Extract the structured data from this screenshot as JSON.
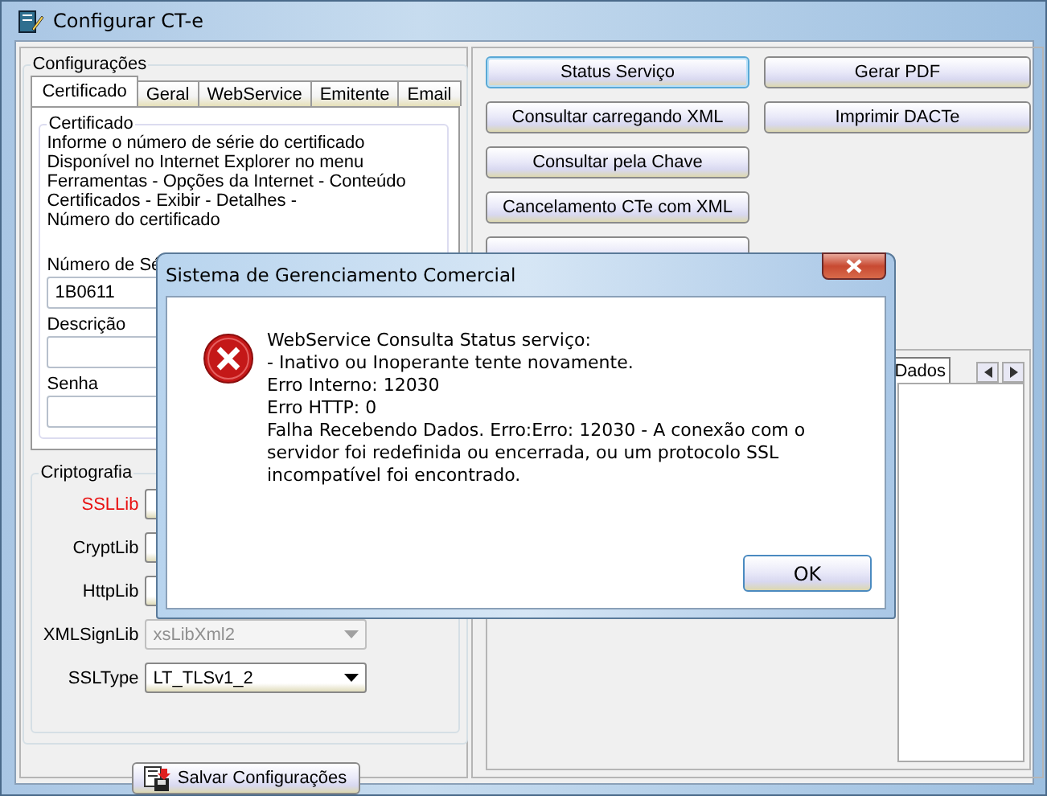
{
  "window": {
    "title": "Configurar CT-e"
  },
  "config": {
    "group_title": "Configurações",
    "tabs": [
      {
        "label": "Certificado",
        "selected": true
      },
      {
        "label": "Geral",
        "selected": false
      },
      {
        "label": "WebService",
        "selected": false
      },
      {
        "label": "Emitente",
        "selected": false
      },
      {
        "label": "Email",
        "selected": false
      }
    ],
    "certificate": {
      "group_title": "Certificado",
      "instructions": [
        "Informe o número de série do certificado",
        "Disponível no Internet Explorer no menu",
        "Ferramentas - Opções da Internet - Conteúdo",
        "Certificados - Exibir - Detalhes -",
        "Número do certificado"
      ],
      "fields": [
        {
          "label": "Número de Sé",
          "value": "1B0611"
        },
        {
          "label": "Descrição"
        },
        {
          "label": "Senha"
        }
      ]
    },
    "crypto": {
      "group_title": "Criptografia",
      "rows": [
        {
          "label": "SSLLib",
          "warning": true,
          "disabled": false
        },
        {
          "label": "CryptLib",
          "warning": false,
          "disabled": false
        },
        {
          "label": "HttpLib",
          "warning": false,
          "disabled": false
        },
        {
          "label": "XMLSignLib",
          "warning": false,
          "disabled": true,
          "value": "xsLibXml2"
        },
        {
          "label": "SSLType",
          "warning": false,
          "disabled": false,
          "value": "LT_TLSv1_2"
        }
      ]
    },
    "save_button": "Salvar Configurações"
  },
  "actions_left": [
    {
      "label": "Status Serviço",
      "focused": true
    },
    {
      "label": "Consultar carregando XML",
      "focused": false
    },
    {
      "label": "Consultar pela Chave",
      "focused": false
    },
    {
      "label": "Cancelamento CTe com XML",
      "focused": false
    },
    {
      "focused": false
    }
  ],
  "actions_right": [
    {
      "label": "Gerar PDF",
      "focused": false
    },
    {
      "label": "Imprimir DACTe",
      "focused": false
    }
  ],
  "results": {
    "tabs": [
      {
        "label": "Dados",
        "selected": true
      }
    ]
  },
  "dialog": {
    "title": "Sistema de Gerenciamento Comercial",
    "message": [
      "WebService Consulta Status serviço:",
      "- Inativo ou Inoperante tente novamente.",
      "Erro Interno: 12030",
      "Erro HTTP: 0",
      "Falha Recebendo Dados. Erro:Erro: 12030 - A conexão com o servidor foi redefinida ou encerrada, ou um protocolo SSL incompatível foi encontrado."
    ],
    "ok_button": "OK"
  }
}
